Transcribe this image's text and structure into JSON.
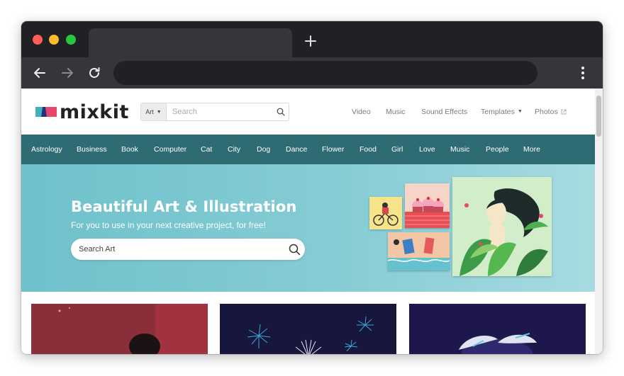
{
  "browser": {
    "tab_title": "",
    "address": "",
    "icons": [
      "close-dot",
      "minimize-dot",
      "maximize-dot",
      "plus-icon",
      "back-arrow-icon",
      "forward-arrow-icon",
      "reload-icon",
      "kebab-menu-icon"
    ]
  },
  "site": {
    "logo_text": "mixkit",
    "search": {
      "category": "Art",
      "placeholder": "Search"
    },
    "topnav": [
      {
        "label": "Video"
      },
      {
        "label": "Music"
      },
      {
        "label": "Sound Effects"
      },
      {
        "label": "Templates"
      },
      {
        "label": "Photos"
      }
    ],
    "categories": [
      "Astrology",
      "Business",
      "Book",
      "Computer",
      "Cat",
      "City",
      "Dog",
      "Dance",
      "Flower",
      "Food",
      "Girl",
      "Love",
      "Music",
      "People",
      "More"
    ],
    "hero": {
      "title": "Beautiful Art & Illustration",
      "subtitle": "For you to use in your next creative project, for free!",
      "search_placeholder": "Search Art"
    }
  },
  "colors": {
    "category_bar": "#2e6b72",
    "hero_gradient_start": "#6ec1cb",
    "hero_gradient_end": "#a7dbe0",
    "logo_accent_teal": "#3fb1bf",
    "logo_accent_red": "#e8476b"
  }
}
